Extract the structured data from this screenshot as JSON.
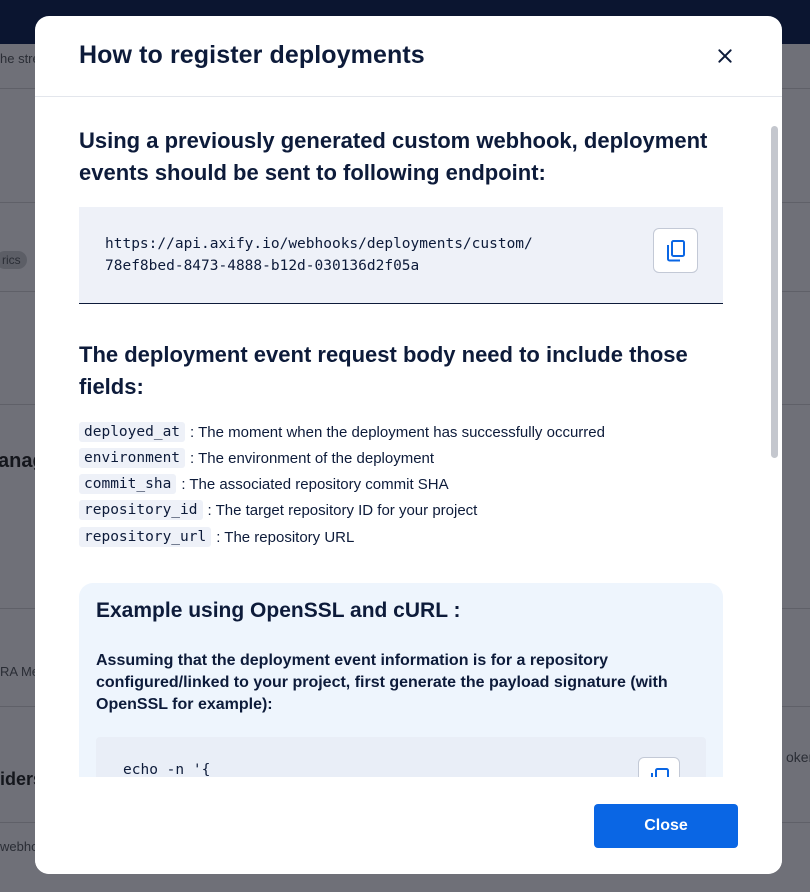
{
  "background": {
    "fragments": [
      "he strea",
      "rics",
      "anag",
      "RA Me",
      "iders",
      "oken",
      "webho"
    ]
  },
  "modal": {
    "title": "How to register deployments",
    "endpoint_heading": "Using a previously generated custom webhook, deployment events should be sent to following endpoint:",
    "endpoint_url": "https://api.axify.io/webhooks/deployments/custom/\n78ef8bed-8473-4888-b12d-030136d2f05a",
    "fields_heading": "The deployment event request body need to include those fields:",
    "fields": [
      {
        "name": "deployed_at",
        "desc": ": The moment when the deployment has successfully occurred"
      },
      {
        "name": "environment",
        "desc": ": The environment of the deployment"
      },
      {
        "name": "commit_sha",
        "desc": ": The associated repository commit SHA"
      },
      {
        "name": "repository_id",
        "desc": ": The target repository ID for your project"
      },
      {
        "name": "repository_url",
        "desc": ": The repository URL"
      }
    ],
    "example": {
      "title": "Example using OpenSSL and cURL :",
      "description": "Assuming that the deployment event information is for a repository configured/linked to your project, first generate the payload signature (with OpenSSL for example):",
      "code": "echo -n '{"
    },
    "close_label": "Close"
  },
  "icons": {
    "close": "close-icon",
    "copy": "copy-icon"
  }
}
